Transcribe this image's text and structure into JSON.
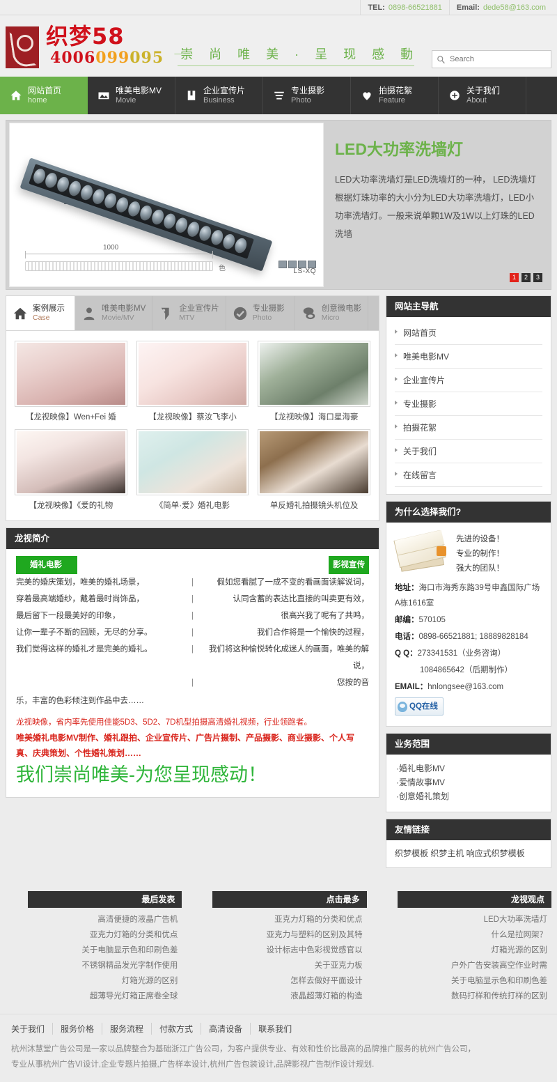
{
  "topbar": {
    "tel_label": "TEL:",
    "tel_value": "0898-66521881",
    "email_label": "Email:",
    "email_value": "dede58@163.com"
  },
  "header": {
    "logo_title": "织梦58",
    "logo_phone": "4006099095",
    "tagline": "崇 尚 唯 美 · 呈 现 感 動",
    "search_placeholder": "Search"
  },
  "mainnav": {
    "items": [
      {
        "cn": "网站首页",
        "en": "home",
        "icon": "home-icon",
        "active": true
      },
      {
        "cn": "唯美电影MV",
        "en": "Movie",
        "icon": "image-icon",
        "active": false
      },
      {
        "cn": "企业宣传片",
        "en": "Business",
        "icon": "book-icon",
        "active": false
      },
      {
        "cn": "专业摄影",
        "en": "Photo",
        "icon": "list-icon",
        "active": false
      },
      {
        "cn": "拍摄花絮",
        "en": "Feature",
        "icon": "heart-icon",
        "active": false
      },
      {
        "cn": "关于我们",
        "en": "About",
        "icon": "plus-circle-icon",
        "active": false
      }
    ]
  },
  "banner": {
    "title": "LED大功率洗墙灯",
    "desc": "LED大功率洗墙灯是LED洗墙灯的一种， LED洗墙灯根据灯珠功率的大小分为LED大功率洗墙灯，LED小功率洗墙灯。一般来说单颗1W及1W以上灯珠的LED洗墙",
    "image_dimension": "1000",
    "image_height_label": "色",
    "image_model": "LS-XQ",
    "dots": [
      "1",
      "2",
      "3"
    ],
    "active_dot": 0,
    "accent_color": "#6cb24a",
    "active_dot_color": "#e2231a"
  },
  "showcase": {
    "tabs": [
      {
        "cn": "案例展示",
        "en": "Case",
        "icon": "home-icon",
        "active": true
      },
      {
        "cn": "唯美电影MV",
        "en": "Movie/MV",
        "icon": "user-icon",
        "active": false
      },
      {
        "cn": "企业宣传片",
        "en": "MTV",
        "icon": "tag-icon",
        "active": false
      },
      {
        "cn": "专业摄影",
        "en": "Photo",
        "icon": "check-circle-icon",
        "active": false
      },
      {
        "cn": "创意微电影",
        "en": "Micro",
        "icon": "chat-icon",
        "active": false
      }
    ],
    "items": [
      {
        "caption": "【龙视映像】Wen+Fei 婚"
      },
      {
        "caption": "【龙视映像】蔡汝飞李小"
      },
      {
        "caption": "【龙视映像】海口星海豪"
      },
      {
        "caption": "【龙视映像】《爱的礼物"
      },
      {
        "caption": "《简单·爱》婚礼电影"
      },
      {
        "caption": "单反婚礼拍摄镜头机位及"
      }
    ]
  },
  "intro": {
    "title": "龙视简介",
    "left_badge": "婚礼电影",
    "right_badge": "影视宣传",
    "rows": [
      {
        "left": "完美的婚庆策划，唯美的婚礼场景，",
        "right": "假如您看腻了一成不变的看画面读解说词，"
      },
      {
        "left": "穿着最高端婚纱，戴着最时尚饰品，",
        "right": "认同含蓄的表达比直接的叫卖更有效，"
      },
      {
        "left": "最后留下一段最美好的印象，",
        "right": "很高兴我了呢有了共鸣，"
      },
      {
        "left": "让你一辈子不断的回顾，无尽的分享。",
        "right": "我们合作将是一个愉快的过程，"
      },
      {
        "left": "我们觉得这样的婚礼才是完美的婚礼。",
        "right": "我们将这种愉悦转化成迷人的画面，唯美的解说，"
      },
      {
        "left": "",
        "right": "您按的音"
      }
    ],
    "tail": "乐，丰富的色彩倾注到作品中去……",
    "red_line": "龙视映像，省内率先使用佳能5D3、5D2、7D机型拍摄高清婚礼视频，行业领跑者。",
    "red_bold": "唯美婚礼电影MV制作、婚礼跟拍、企业宣传片、广告片摄制、产品摄影、商业摄影、个人写真、庆典策划、个性婚礼策划……",
    "slogan": "我们崇尚唯美-为您呈现感动！"
  },
  "sidebar": {
    "nav": {
      "title": "网站主导航",
      "items": [
        "网站首页",
        "唯美电影MV",
        "企业宣传片",
        "专业摄影",
        "拍摄花絮",
        "关于我们",
        "在线留言"
      ]
    },
    "why": {
      "title": "为什么选择我们?",
      "claims": [
        "先进的设备！",
        "专业的制作！",
        "强大的团队！"
      ],
      "address_label": "地址：",
      "address_value": "海口市海秀东路39号申鑫国际广场A栋1616室",
      "zip_label": "邮编：",
      "zip_value": "570105",
      "phone_label": "电话：",
      "phone_value": "0898-66521881; 18889828184",
      "qq_label": "Q Q：",
      "qq_value": "273341531（业务咨询）",
      "qq_value2": "1084865642（后期制作）",
      "email_label": "EMAIL：",
      "email_value": "hnlongsee@163.com",
      "qq_button": "QQ在线"
    },
    "biz": {
      "title": "业务范围",
      "items": [
        "·婚礼电影MV",
        "·爱情故事MV",
        "·创意婚礼策划"
      ]
    },
    "links": {
      "title": "友情链接",
      "text": "织梦模板 织梦主机 响应式织梦模板"
    }
  },
  "footlists": [
    {
      "title": "最后发表",
      "items": [
        "高清便捷的液晶广告机",
        "亚克力灯箱的分类和优点",
        "关于电脑显示色和印刷色差",
        "不锈钢精品发光字制作使用",
        "灯箱光源的区别",
        "超薄导光灯箱正席卷全球"
      ]
    },
    {
      "title": "点击最多",
      "items": [
        "亚克力灯箱的分类和优点",
        "亚克力与塑料的区别及其特",
        "设计标志中色彩视觉感官以",
        "关于亚克力板",
        "怎样去做好平面设计",
        "液晶超薄灯箱的构造"
      ]
    },
    {
      "title": "龙视观点",
      "items": [
        "LED大功率洗墙灯",
        "什么是拉网架？",
        "灯箱光源的区别",
        "户外广告安装高空作业时需",
        "关于电脑显示色和印刷色差",
        "数码打样和传统打样的区别"
      ]
    }
  ],
  "footer": {
    "nav": [
      "关于我们",
      "服务价格",
      "服务流程",
      "付款方式",
      "高清设备",
      "联系我们"
    ],
    "copy_line1": "杭州沐慧堂广告公司是一家以品牌整合为基础浙江广告公司，为客户提供专业、有效和性价比最高的品牌推广服务的杭州广告公司，",
    "copy_line2": "专业从事杭州广告VI设计,企业专题片拍摄,广告样本设计,杭州广告包装设计,品牌影视广告制作设计规划."
  }
}
